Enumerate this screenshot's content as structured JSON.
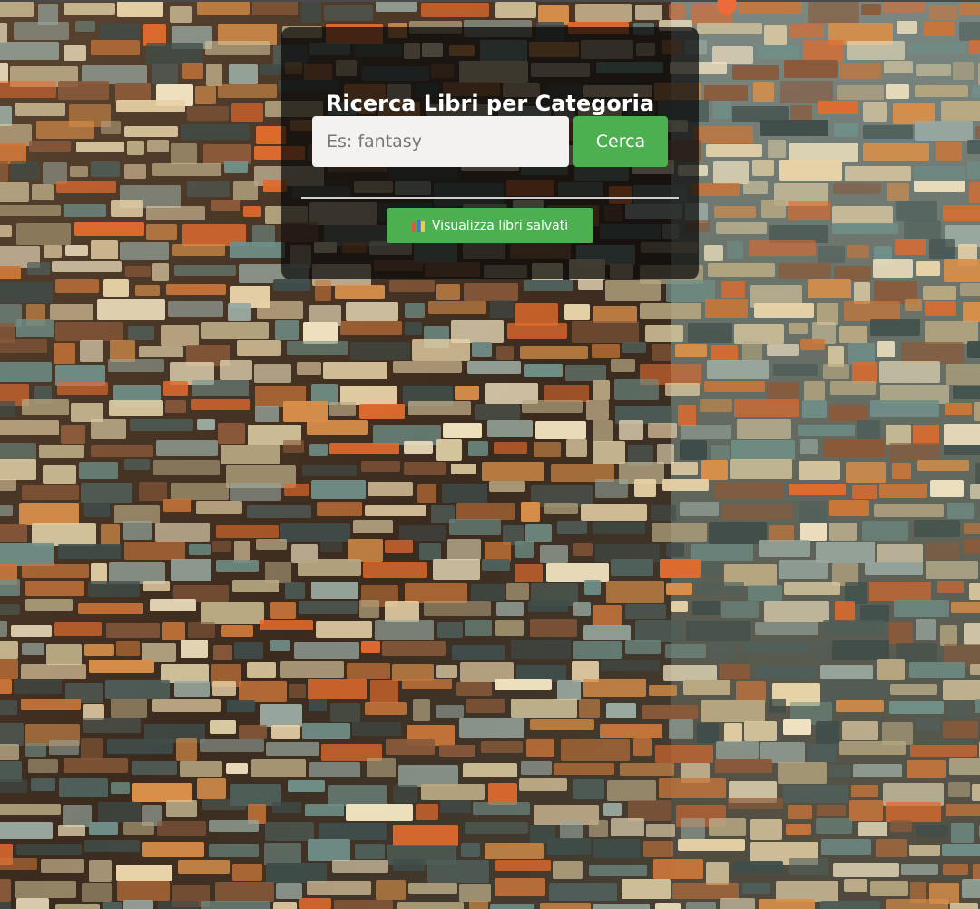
{
  "search_panel": {
    "title": "Ricerca Libri per Categoria",
    "search_input": {
      "value": "",
      "placeholder": "Es: fantasy"
    },
    "search_button_label": "Cerca",
    "saved_books_button": {
      "icon": "books-icon",
      "label": "Visualizza libri salvati"
    }
  },
  "background": {
    "description_icon": "library-bookshelves-illustration"
  },
  "colors": {
    "accent_green": "#4caf50",
    "panel_overlay": "#080808",
    "input_bg": "#f4f1f1",
    "corner_dot": "#ee6a3a"
  }
}
